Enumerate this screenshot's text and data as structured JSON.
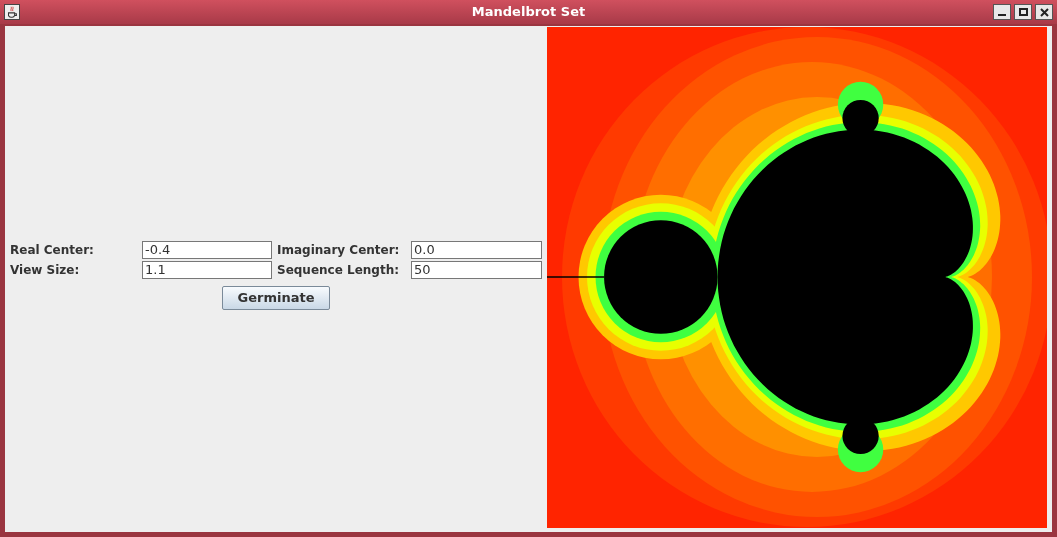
{
  "window": {
    "title": "Mandelbrot Set"
  },
  "form": {
    "fields": [
      {
        "label": "Real Center:",
        "value": "-0.4"
      },
      {
        "label": "Imaginary Center:",
        "value": "0.0"
      },
      {
        "label": "View Size:",
        "value": "1.1"
      },
      {
        "label": "Sequence Length:",
        "value": "50"
      }
    ],
    "button": "Germinate"
  }
}
